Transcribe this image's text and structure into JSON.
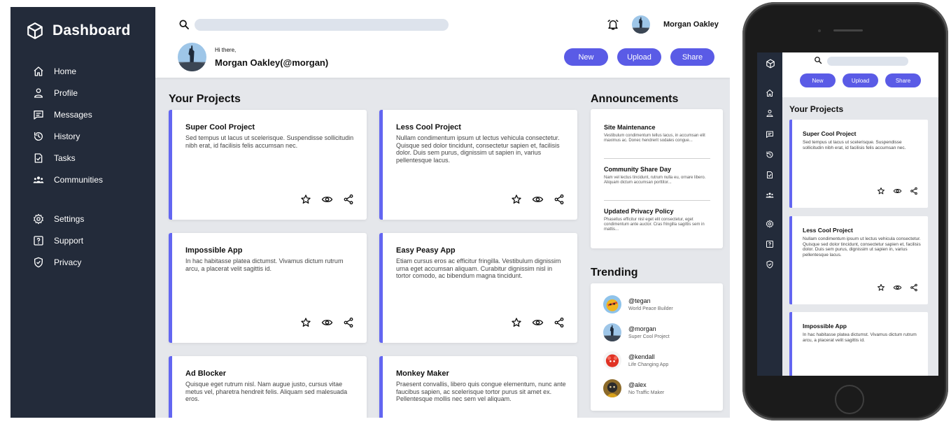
{
  "app": {
    "title": "Dashboard"
  },
  "sidebar": {
    "items": [
      {
        "label": "Home",
        "icon": "home-icon"
      },
      {
        "label": "Profile",
        "icon": "user-icon"
      },
      {
        "label": "Messages",
        "icon": "message-icon"
      },
      {
        "label": "History",
        "icon": "history-icon"
      },
      {
        "label": "Tasks",
        "icon": "tasks-icon"
      },
      {
        "label": "Communities",
        "icon": "communities-icon"
      },
      {
        "label": "Settings",
        "icon": "gear-icon"
      },
      {
        "label": "Support",
        "icon": "help-icon"
      },
      {
        "label": "Privacy",
        "icon": "shield-icon"
      }
    ]
  },
  "header": {
    "search_placeholder": "",
    "user_name": "Morgan Oakley",
    "greeting": "Hi there,",
    "full_name": "Morgan Oakley(@morgan)",
    "buttons": {
      "new": "New",
      "upload": "Upload",
      "share": "Share"
    }
  },
  "projects": {
    "heading": "Your Projects",
    "items": [
      {
        "title": "Super Cool Project",
        "desc": "Sed tempus ut lacus ut scelerisque. Suspendisse sollicitudin nibh erat, id facilisis felis accumsan nec."
      },
      {
        "title": "Less Cool Project",
        "desc": "Nullam condimentum ipsum ut lectus vehicula consectetur. Quisque sed dolor tincidunt, consectetur sapien et, facilisis dolor. Duis sem purus, dignissim ut sapien in, varius pellentesque lacus."
      },
      {
        "title": "Impossible App",
        "desc": "In hac habitasse platea dictumst. Vivamus dictum rutrum arcu, a placerat velit sagittis id."
      },
      {
        "title": "Easy Peasy App",
        "desc": "Etiam cursus eros ac efficitur fringilla. Vestibulum dignissim urna eget accumsan aliquam. Curabitur dignissim nisl in tortor comodo, ac bibendum magna tincidunt."
      },
      {
        "title": "Ad Blocker",
        "desc": "Quisque eget rutrum nisl. Nam augue justo, cursus vitae metus vel, pharetra hendreit felis. Aliquam sed malesuada eros."
      },
      {
        "title": "Monkey Maker",
        "desc": "Praesent convallis, libero quis congue elementum, nunc ante faucibus sapien, ac scelerisque tortor purus sit amet ex. Pellentesque mollis nec sem vel aliquam."
      }
    ]
  },
  "announcements": {
    "heading": "Announcements",
    "items": [
      {
        "title": "Site Maintenance",
        "desc": "Vestibulum condimentum tellus lacus, in accumsan elit maximus ac. Donec hendrerit sodales congue..."
      },
      {
        "title": "Community Share Day",
        "desc": "Nam vel lectus tincidunt, rutrum nulla eu, ornare libero. Aliquam dictum accumsan porttitor..."
      },
      {
        "title": "Updated Privacy Policy",
        "desc": "Phasellus efficitur nisl eget elit consectetur, eget condimentum ante auctor. Cras fringilla sagittis sem in mattis..."
      }
    ]
  },
  "trending": {
    "heading": "Trending",
    "items": [
      {
        "handle": "@tegan",
        "sub": "World Peace Builder"
      },
      {
        "handle": "@morgan",
        "sub": "Super Cool Project"
      },
      {
        "handle": "@kendall",
        "sub": "Life Changing App"
      },
      {
        "handle": "@alex",
        "sub": "No Traffic Maker"
      }
    ]
  },
  "colors": {
    "sidebar": "#232b3a",
    "accent": "#5a5be6",
    "card_border": "#6366f1",
    "background": "#e5e7eb"
  }
}
